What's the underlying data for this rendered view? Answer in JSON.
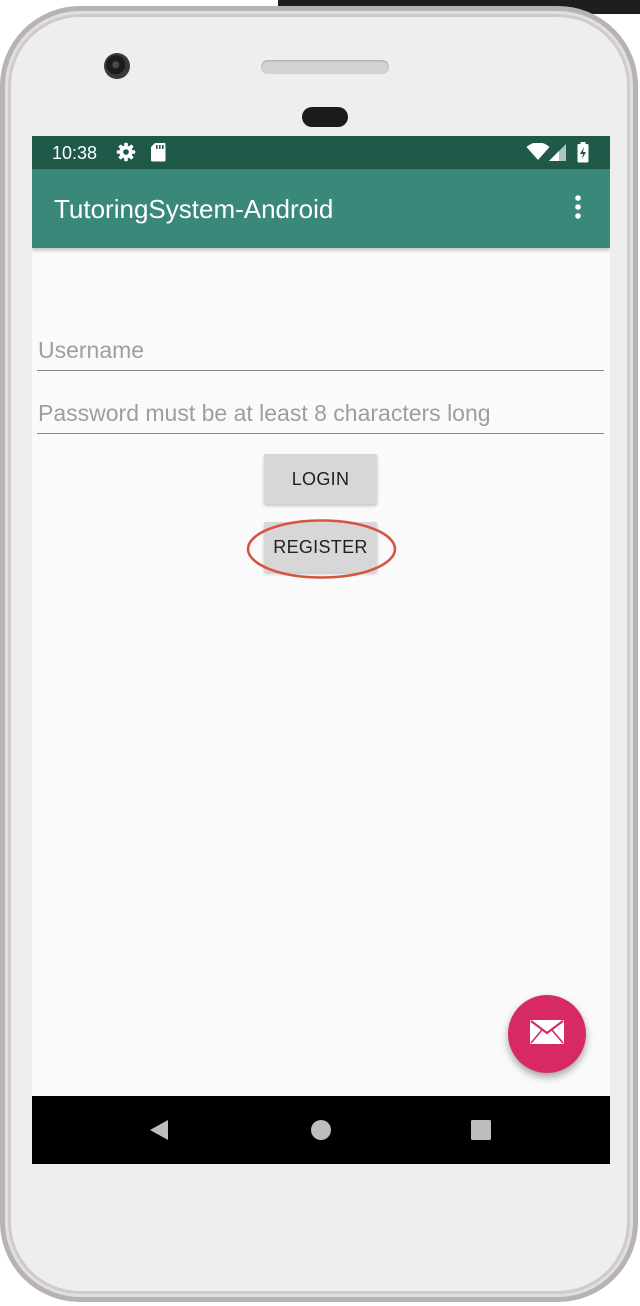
{
  "status_bar": {
    "time": "10:38",
    "icons": [
      "settings-gear-icon",
      "sd-card-icon",
      "wifi-icon",
      "cell-signal-icon",
      "battery-charging-icon"
    ]
  },
  "app_bar": {
    "title": "TutoringSystem-Android",
    "overflow_icon": "more-vert-icon"
  },
  "login_form": {
    "username_placeholder": "Username",
    "password_placeholder": "Password must be at least 8 characters long",
    "login_label": "LOGIN",
    "register_label": "REGISTER"
  },
  "fab": {
    "icon": "mail-icon"
  },
  "nav_bar": {
    "icons": [
      "back-triangle-icon",
      "home-circle-icon",
      "recents-square-icon"
    ]
  },
  "colors": {
    "status_bar": "#1f5949",
    "app_bar": "#3a8879",
    "fab": "#d72a63",
    "annotation": "#d5553f"
  }
}
